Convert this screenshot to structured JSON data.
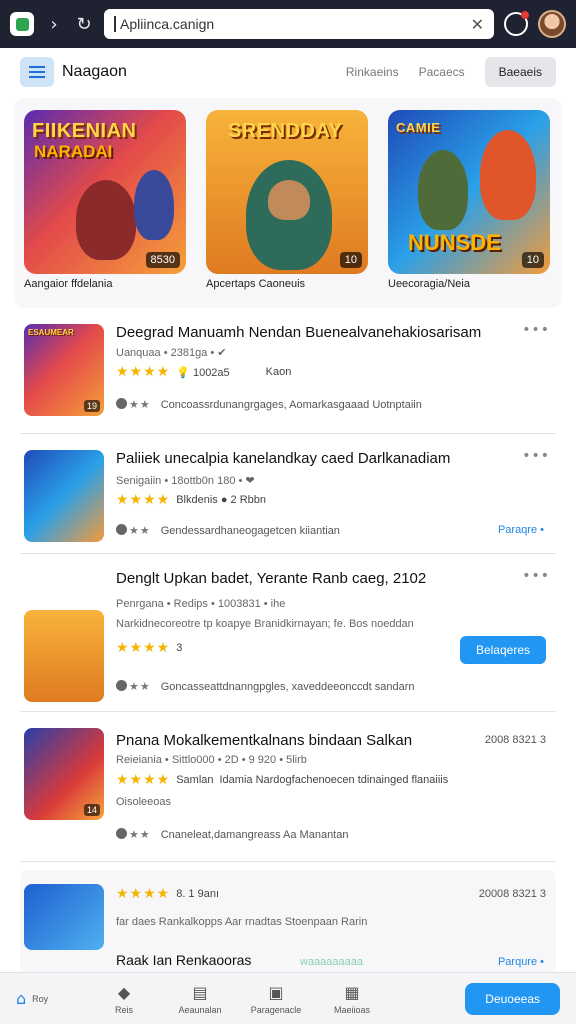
{
  "browser": {
    "url": "Apliinca.canign",
    "icons": [
      "tab-icon",
      "forward-icon",
      "reload-icon",
      "clear-icon",
      "extension-icon",
      "profile-avatar"
    ]
  },
  "header": {
    "title": "Naagaon",
    "links": [
      "Rinkaeins",
      "Pacaecs"
    ],
    "button": "Baeaeis"
  },
  "featured": [
    {
      "art_title": "FIIKENIAN",
      "art_sub": "NARADAI",
      "rating": "8530",
      "label": "Aangaior ffdelania"
    },
    {
      "art_title": "SRENDDAY",
      "art_sub": "",
      "rating": "10",
      "label": "Apcertaps Caoneuis"
    },
    {
      "art_title": "CAMIE",
      "art_sub": "NUNSDE",
      "rating": "10",
      "label": "Ueecoragia/Neia"
    }
  ],
  "items": [
    {
      "thumb_title": "ESAUMEAR",
      "thumb_badge": "19",
      "title": "Deegrad Manuamh Nendan Buenealvanehakiosarisam",
      "meta": "Uanquaa • 2381ga • ✔",
      "stars": "★★★★",
      "rating_text": "💡 1002a5",
      "extra": "Kaon",
      "foot": "Concoassrdunangrgages, Aomarkasgaaad Uotnptaiin",
      "link": ""
    },
    {
      "thumb_title": "",
      "thumb_badge": "",
      "title": "Paliiek unecalpia kanelandkay caed Darlkanadiam",
      "meta": "Senigaiin • 18ottb0n 180 • ❤",
      "stars": "★★★★",
      "rating_text": "Blkdenis  ● 2  Rbbn",
      "extra": "",
      "foot": "Gendessardhaneogagetcen kiiantian",
      "link": "Paraqre •"
    },
    {
      "thumb_title": "",
      "thumb_badge": "",
      "title": "Denglt Upkan badet, Yerante Ranb caeg, 2102",
      "meta": "Penrgana • Redips • 1003831 • ihe",
      "desc": "Narkidnecoreotre tp koapye Branidkirnayan; fe. Bos noeddan",
      "stars": "★★★★",
      "rating_text": "3",
      "extra": "",
      "foot": "Goncasseattdnanngpgles, xaveddeeonccdt sandarn",
      "button": "Belaqeres"
    },
    {
      "thumb_title": "",
      "thumb_badge": "14",
      "title": "Pnana Mokalkementkalnans bindaan Salkan",
      "meta": "Reieiania • Sittlo000 • 2D • 9 920 • 5lirb",
      "right_meta": "2008 8321 3",
      "stars": "★★★★",
      "rating_text": "Samlan",
      "extra": "Idamia Nardogfachenoecen tdinainged flanaiiis",
      "sub": "Oisoleeoas",
      "foot": "Cnaneleat,damangreass Aa Manantan"
    },
    {
      "stars": "★★★★",
      "rating_text": "8. 1 9anı",
      "right_meta": "20008 8321 3",
      "desc": "far daes Rankalkopps Aar rnadtas Stoenpaan Rarin",
      "title": "Raak Ian Renkaooras",
      "extra": "waaaaaaaaa",
      "link": "Parqure •"
    }
  ],
  "bottom_nav": {
    "home_label": "Roy",
    "items": [
      "Reis",
      "Aeaunalan",
      "Paragenacle",
      "Maeiioas"
    ],
    "button": "Deuoeeas"
  },
  "colors": {
    "accent": "#2196f3",
    "star": "#f4b400",
    "chrome": "#1f2230"
  }
}
